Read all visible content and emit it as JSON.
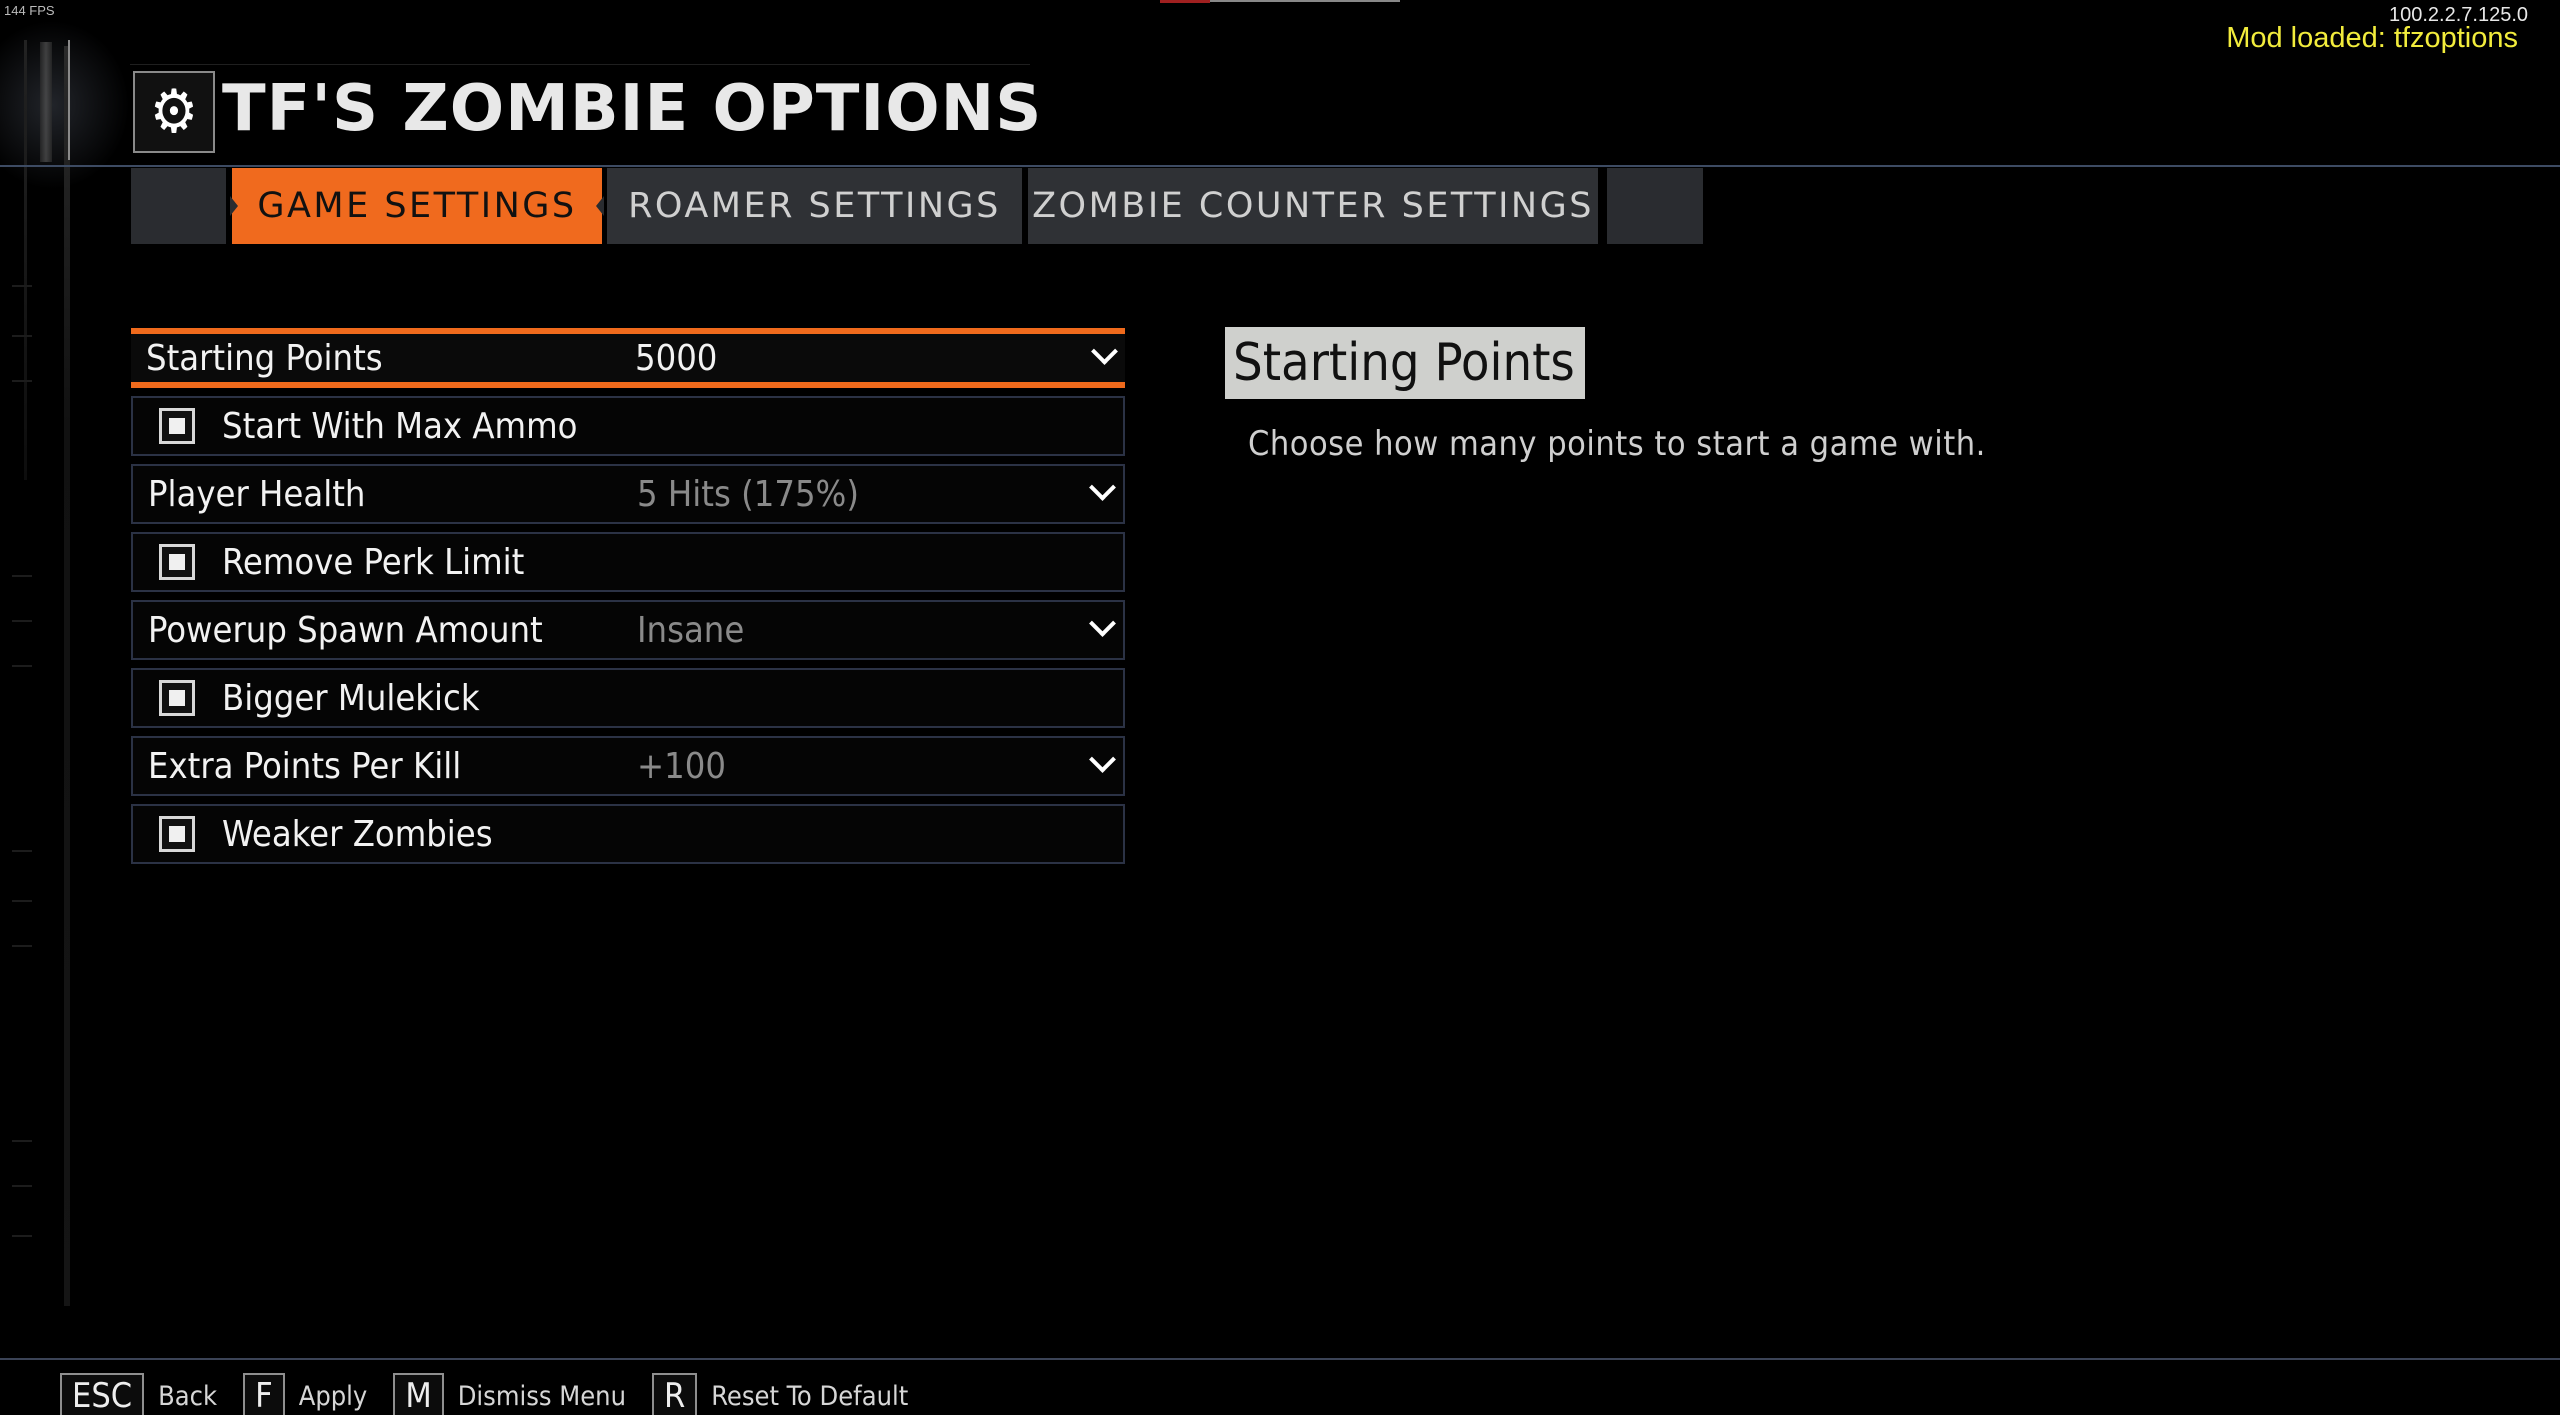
{
  "overlay": {
    "fps": "144 FPS",
    "version": "100.2.2.7.125.0",
    "mod_loaded": "Mod loaded: tfzoptions"
  },
  "header": {
    "icon": "gears-icon",
    "title": "TF'S ZOMBIE OPTIONS"
  },
  "tabs": [
    {
      "label": "GAME SETTINGS",
      "active": true
    },
    {
      "label": "ROAMER SETTINGS",
      "active": false
    },
    {
      "label": "ZOMBIE COUNTER SETTINGS",
      "active": false
    }
  ],
  "options": {
    "starting_points": {
      "label": "Starting Points",
      "value": "5000"
    },
    "max_ammo": {
      "label": "Start With Max Ammo"
    },
    "player_health": {
      "label": "Player Health",
      "value": "5 Hits (175%)"
    },
    "perk_limit": {
      "label": "Remove Perk Limit"
    },
    "powerup_spawn": {
      "label": "Powerup Spawn Amount",
      "value": "Insane"
    },
    "mulekick": {
      "label": "Bigger Mulekick"
    },
    "extra_points": {
      "label": "Extra Points Per Kill",
      "value": "+100"
    },
    "weaker_zombies": {
      "label": "Weaker Zombies"
    }
  },
  "description": {
    "title": "Starting Points",
    "text": "Choose how many points to start a game with."
  },
  "footer": {
    "back": {
      "key": "ESC",
      "label": "Back"
    },
    "apply": {
      "key": "F",
      "label": "Apply"
    },
    "dismiss": {
      "key": "M",
      "label": "Dismiss Menu"
    },
    "reset": {
      "key": "R",
      "label": "Reset To Default"
    }
  },
  "colors": {
    "accent": "#ef6a1c",
    "mod_text": "#f2ec3c",
    "description_bg": "#cfd0cd"
  }
}
